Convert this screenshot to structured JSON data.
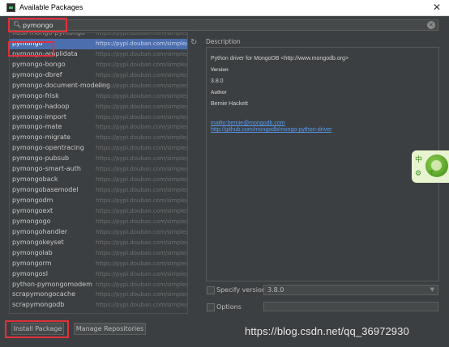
{
  "window": {
    "title": "Available Packages",
    "close_glyph": "✕"
  },
  "search": {
    "value": "pymongo",
    "icon": "search-icon"
  },
  "packages": [
    {
      "name": "flask-mongo-pymongo",
      "repo": "https://pypi.douban.com/simple/"
    },
    {
      "name": "pymongo",
      "repo": "https://pypi.douban.com/simple/"
    },
    {
      "name": "pymongo-amplidata",
      "repo": "https://pypi.douban.com/simple/"
    },
    {
      "name": "pymongo-bongo",
      "repo": "https://pypi.douban.com/simple/"
    },
    {
      "name": "pymongo-dbref",
      "repo": "https://pypi.douban.com/simple/"
    },
    {
      "name": "pymongo-document-modeling",
      "repo": "https://pypi.douban.com/simple/"
    },
    {
      "name": "pymongo-frisk",
      "repo": "https://pypi.douban.com/simple/"
    },
    {
      "name": "pymongo-hadoop",
      "repo": "https://pypi.douban.com/simple/"
    },
    {
      "name": "pymongo-import",
      "repo": "https://pypi.douban.com/simple/"
    },
    {
      "name": "pymongo-mate",
      "repo": "https://pypi.douban.com/simple/"
    },
    {
      "name": "pymongo-migrate",
      "repo": "https://pypi.douban.com/simple/"
    },
    {
      "name": "pymongo-opentracing",
      "repo": "https://pypi.douban.com/simple/"
    },
    {
      "name": "pymongo-pubsub",
      "repo": "https://pypi.douban.com/simple/"
    },
    {
      "name": "pymongo-smart-auth",
      "repo": "https://pypi.douban.com/simple/"
    },
    {
      "name": "pymongoback",
      "repo": "https://pypi.douban.com/simple/"
    },
    {
      "name": "pymongobasemodel",
      "repo": "https://pypi.douban.com/simple/"
    },
    {
      "name": "pymongodm",
      "repo": "https://pypi.douban.com/simple/"
    },
    {
      "name": "pymongoext",
      "repo": "https://pypi.douban.com/simple/"
    },
    {
      "name": "pymongogo",
      "repo": "https://pypi.douban.com/simple/"
    },
    {
      "name": "pymongohandler",
      "repo": "https://pypi.douban.com/simple/"
    },
    {
      "name": "pymongokeyset",
      "repo": "https://pypi.douban.com/simple/"
    },
    {
      "name": "pymongolab",
      "repo": "https://pypi.douban.com/simple/"
    },
    {
      "name": "pymongorm",
      "repo": "https://pypi.douban.com/simple/"
    },
    {
      "name": "pymongosl",
      "repo": "https://pypi.douban.com/simple/"
    },
    {
      "name": "python-pymongomodem",
      "repo": "https://pypi.douban.com/simple/"
    },
    {
      "name": "scrapymongocache",
      "repo": "https://pypi.douban.com/simple/"
    },
    {
      "name": "scrapymongodb",
      "repo": "https://pypi.douban.com/simple/"
    }
  ],
  "selected_package": "pymongo",
  "description": {
    "label": "Description",
    "summary": "Python driver for MongoDB <http://www.mongodb.org>",
    "version_heading": "Version",
    "version": "3.8.0",
    "author_heading": "Author",
    "author": "Bernie Hackett",
    "email_link": "mailto:bernie@mongodb.com",
    "repo_link": "http://github.com/mongodb/mongo-python-driver"
  },
  "specify_version": {
    "label": "Specify version",
    "checked": false,
    "value": "3.8.0"
  },
  "options": {
    "label": "Options",
    "checked": false,
    "value": ""
  },
  "buttons": {
    "install": "Install Package",
    "manage": "Manage Repositories"
  },
  "watermark": "https://blog.csdn.net/qq_36972930",
  "colors": {
    "background": "#3c3f41",
    "selection": "#4b6eaf",
    "highlight_box": "#e0313a",
    "link": "#589df6"
  }
}
